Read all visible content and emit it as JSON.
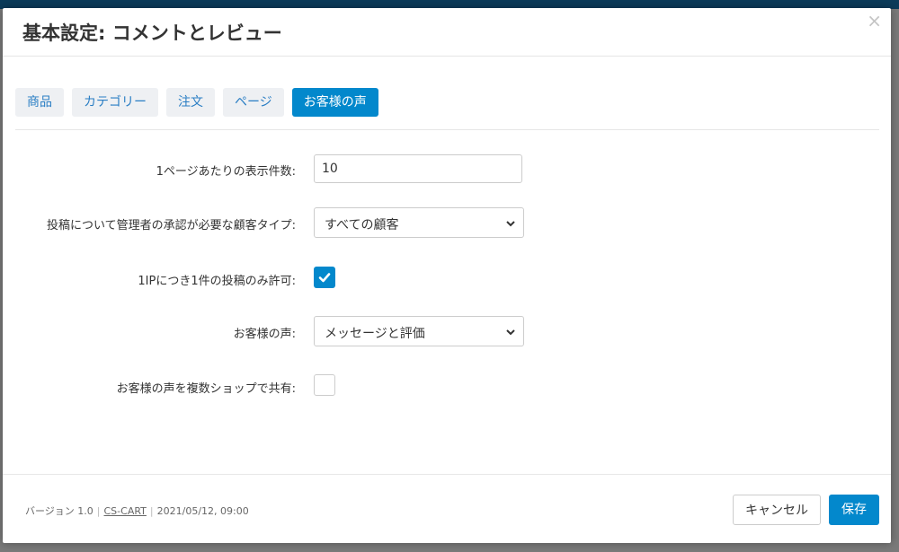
{
  "modal": {
    "title": "基本設定: コメントとレビュー",
    "close_symbol": "×"
  },
  "tabs": [
    {
      "label": "商品",
      "active": false
    },
    {
      "label": "カテゴリー",
      "active": false
    },
    {
      "label": "注文",
      "active": false
    },
    {
      "label": "ページ",
      "active": false
    },
    {
      "label": "お客様の声",
      "active": true
    }
  ],
  "form": {
    "items_per_page": {
      "label": "1ページあたりの表示件数:",
      "value": "10"
    },
    "approval_type": {
      "label": "投稿について管理者の承認が必要な顧客タイプ:",
      "value": "すべての顧客"
    },
    "one_per_ip": {
      "label": "1IPにつき1件の投稿のみ許可:",
      "checked": true
    },
    "testimonials": {
      "label": "お客様の声:",
      "value": "メッセージと評価"
    },
    "share_multi_shop": {
      "label": "お客様の声を複数ショップで共有:",
      "checked": false
    }
  },
  "footer": {
    "version": "バージョン 1.0",
    "brand_link": "CS-CART",
    "date": "2021/05/12, 09:00",
    "cancel_label": "キャンセル",
    "save_label": "保存"
  },
  "colors": {
    "accent": "#0388cc",
    "tab_bg": "#eef0f3",
    "tab_text": "#2a7ec4"
  },
  "icons": {
    "close": "close-icon",
    "dropdown": "chevron-down-icon",
    "check": "check-icon"
  }
}
